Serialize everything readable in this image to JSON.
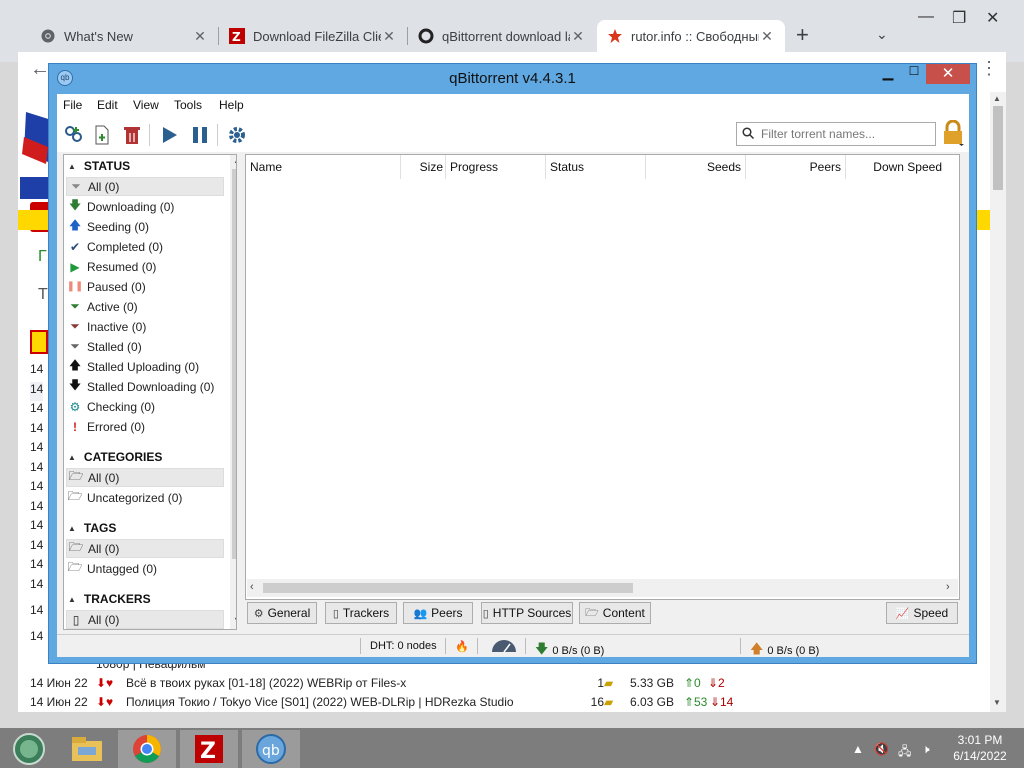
{
  "browser": {
    "tabs": [
      {
        "title": "What's New",
        "icon": "chrome-icon"
      },
      {
        "title": "Download FileZilla Clier",
        "icon": "filezilla-icon"
      },
      {
        "title": "qBittorrent download la",
        "icon": "qbittorrent-site-icon"
      },
      {
        "title": "rutor.info :: Свободный",
        "icon": "rutor-icon"
      }
    ],
    "new_tab_label": "+",
    "tab_search_label": "⌄"
  },
  "webpage": {
    "dates": [
      "14",
      "14",
      "14",
      "14",
      "14",
      "14",
      "14",
      "14",
      "14",
      "14",
      "14",
      "14",
      "14",
      "14"
    ],
    "torrent_rows": [
      {
        "date": "",
        "title": "1080р | Невафильм",
        "comments": "",
        "size": "",
        "seeds": "",
        "peers": ""
      },
      {
        "date": "14 Июн 22",
        "title": "Всё в твоих руках [01-18] (2022) WEBRip от Files-x",
        "comments": "1",
        "size": "5.33 GB",
        "seeds": "0",
        "peers": "2"
      },
      {
        "date": "14 Июн 22",
        "title": "Полиция Токио / Tokyo Vice [S01] (2022) WEB-DLRip | HDRezka Studio",
        "comments": "16",
        "size": "6.03 GB",
        "seeds": "53",
        "peers": "14"
      }
    ]
  },
  "qbittorrent": {
    "title": "qBittorrent v4.4.3.1",
    "menu": [
      "File",
      "Edit",
      "View",
      "Tools",
      "Help"
    ],
    "filter_placeholder": "Filter torrent names...",
    "sidebar": {
      "status_header": "STATUS",
      "status_items": [
        {
          "label": "All (0)",
          "icon": "filter-icon",
          "color": "#888888"
        },
        {
          "label": "Downloading (0)",
          "icon": "arrow-down-icon",
          "color": "#2e7d32"
        },
        {
          "label": "Seeding (0)",
          "icon": "arrow-up-icon",
          "color": "#1e63c5"
        },
        {
          "label": "Completed (0)",
          "icon": "checkmark-icon",
          "color": "#2b4a7a"
        },
        {
          "label": "Resumed (0)",
          "icon": "play-icon",
          "color": "#1f9a3a"
        },
        {
          "label": "Paused (0)",
          "icon": "pause-icon",
          "color": "#ef8a7a"
        },
        {
          "label": "Active (0)",
          "icon": "filter-icon",
          "color": "#2e7d32"
        },
        {
          "label": "Inactive (0)",
          "icon": "filter-icon",
          "color": "#8b3a3a"
        },
        {
          "label": "Stalled (0)",
          "icon": "filter-icon",
          "color": "#666666"
        },
        {
          "label": "Stalled Uploading (0)",
          "icon": "arrow-up-icon",
          "color": "#111111"
        },
        {
          "label": "Stalled Downloading (0)",
          "icon": "arrow-down-icon",
          "color": "#111111"
        },
        {
          "label": "Checking (0)",
          "icon": "gear-icon",
          "color": "#16898e"
        },
        {
          "label": "Errored (0)",
          "icon": "exclamation-icon",
          "color": "#d32020"
        }
      ],
      "categories_header": "CATEGORIES",
      "category_items": [
        "All (0)",
        "Uncategorized (0)"
      ],
      "tags_header": "TAGS",
      "tag_items": [
        "All (0)",
        "Untagged (0)"
      ],
      "trackers_header": "TRACKERS",
      "tracker_items": [
        "All (0)"
      ]
    },
    "columns": [
      "Name",
      "Size",
      "Progress",
      "Status",
      "Seeds",
      "Peers",
      "Down Speed"
    ],
    "bottom_tabs": [
      "General",
      "Trackers",
      "Peers",
      "HTTP Sources",
      "Content"
    ],
    "speed_tab": "Speed",
    "statusbar": {
      "dht": "DHT: 0 nodes",
      "download": "0 B/s (0 B)",
      "upload": "0 B/s (0 B)"
    }
  },
  "taskbar": {
    "time": "3:01 PM",
    "date": "6/14/2022",
    "apps": [
      "desktop-orb",
      "file-explorer",
      "chrome",
      "filezilla",
      "qbittorrent"
    ]
  }
}
